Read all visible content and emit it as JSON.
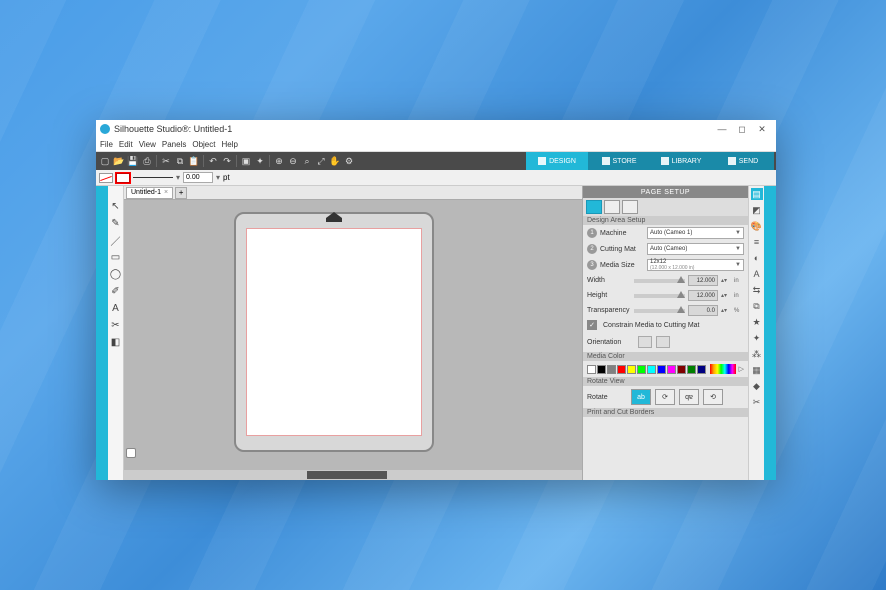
{
  "app": {
    "title": "Silhouette Studio®: Untitled-1"
  },
  "menu": [
    "File",
    "Edit",
    "View",
    "Panels",
    "Object",
    "Help"
  ],
  "main_tabs": {
    "design": "DESIGN",
    "store": "STORE",
    "library": "LIBRARY",
    "send": "SEND"
  },
  "line_weight": "0.00",
  "line_unit": "pt",
  "doc_tab": "Untitled-1",
  "panel": {
    "title": "PAGE SETUP",
    "section_design": "Design Area Setup",
    "machine_label": "Machine",
    "machine_value": "Auto (Cameo 1)",
    "mat_label": "Cutting Mat",
    "mat_value": "Auto (Cameo)",
    "media_label": "Media Size",
    "media_value": "12x12",
    "media_sub": "(12.000 x 12.000 in)",
    "width_label": "Width",
    "width_value": "12.000",
    "height_label": "Height",
    "height_value": "12.000",
    "unit_in": "in",
    "trans_label": "Transparency",
    "trans_value": "0.0",
    "unit_pct": "%",
    "constrain": "Constrain Media to Cutting Mat",
    "orient_label": "Orientation",
    "section_color": "Media Color",
    "section_rotate": "Rotate View",
    "rotate_label": "Rotate",
    "section_print": "Print and Cut Borders"
  },
  "swatches": [
    "#ffffff",
    "#000000",
    "#808080",
    "#ff0000",
    "#ffff00",
    "#00ff00",
    "#00ffff",
    "#0000ff",
    "#ff00ff",
    "#800000",
    "#008000",
    "#000080"
  ]
}
